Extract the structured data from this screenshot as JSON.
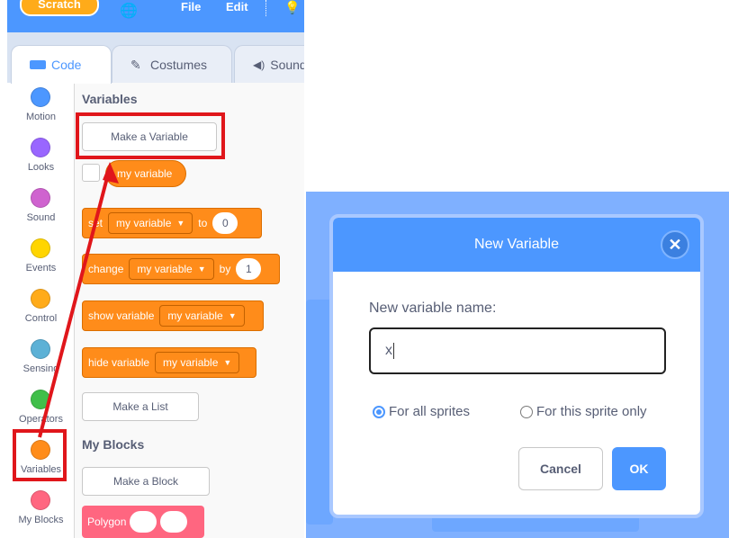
{
  "menubar": {
    "logo_text": "Scratch",
    "file_label": "File",
    "edit_label": "Edit"
  },
  "tabs": [
    {
      "label": "Code",
      "icon": "code-icon"
    },
    {
      "label": "Costumes",
      "icon": "brush-icon"
    },
    {
      "label": "Sounds",
      "icon": "speaker-icon"
    }
  ],
  "categories": [
    {
      "label": "Motion",
      "color": "#4c97ff"
    },
    {
      "label": "Looks",
      "color": "#9966ff"
    },
    {
      "label": "Sound",
      "color": "#cf63cf"
    },
    {
      "label": "Events",
      "color": "#ffd500"
    },
    {
      "label": "Control",
      "color": "#ffab19"
    },
    {
      "label": "Sensing",
      "color": "#5cb1d6"
    },
    {
      "label": "Operators",
      "color": "#40bf4a"
    },
    {
      "label": "Variables",
      "color": "#ff8c1a"
    },
    {
      "label": "My Blocks",
      "color": "#ff6680"
    }
  ],
  "palette": {
    "variables_title": "Variables",
    "make_variable_label": "Make a Variable",
    "my_variable_label": "my variable",
    "set_block": {
      "verb": "set",
      "var": "my variable",
      "prep": "to",
      "value": "0"
    },
    "change_block": {
      "verb": "change",
      "var": "my variable",
      "prep": "by",
      "value": "1"
    },
    "show_block": {
      "verb": "show variable",
      "var": "my variable"
    },
    "hide_block": {
      "verb": "hide variable",
      "var": "my variable"
    },
    "make_list_label": "Make a List",
    "my_blocks_title": "My Blocks",
    "make_block_label": "Make a Block",
    "polygon_label": "Polygon"
  },
  "dialog": {
    "title": "New Variable",
    "prompt": "New variable name:",
    "input_value": "x",
    "option_all": "For all sprites",
    "option_this": "For this sprite only",
    "selected_option": "all",
    "cancel_label": "Cancel",
    "ok_label": "OK"
  },
  "colors": {
    "accent": "#4c97ff",
    "variables_orange": "#ff8c1a",
    "highlight_red": "#e0161b"
  }
}
